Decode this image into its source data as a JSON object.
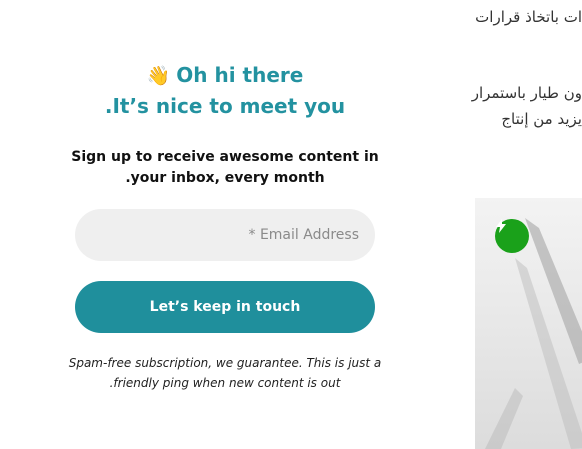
{
  "background_text": {
    "line1": "ات باتخاذ قرارات",
    "line2": "ون طيار باستمرار",
    "line3": "يزيد من إنتاج"
  },
  "signup": {
    "greeting_emoji": "👋",
    "greeting_line1": "Oh hi there",
    "greeting_line2": ".It’s nice to meet you",
    "subline_1": "Sign up to receive awesome content in",
    "subline_2": ".your inbox, every month",
    "email_placeholder": "* Email Address",
    "cta_label": "Let’s keep in touch",
    "disclaimer_1": "Spam-free subscription, we guarantee. This is just a",
    "disclaimer_2": ".friendly ping when new content is out"
  },
  "colors": {
    "accent": "#2392a0",
    "button": "#1f8f9c",
    "input_bg": "#efefef",
    "badge": "#1aa11a"
  },
  "icons": {
    "greeting": "waving-hand-icon",
    "badge": "lightning-icon"
  }
}
